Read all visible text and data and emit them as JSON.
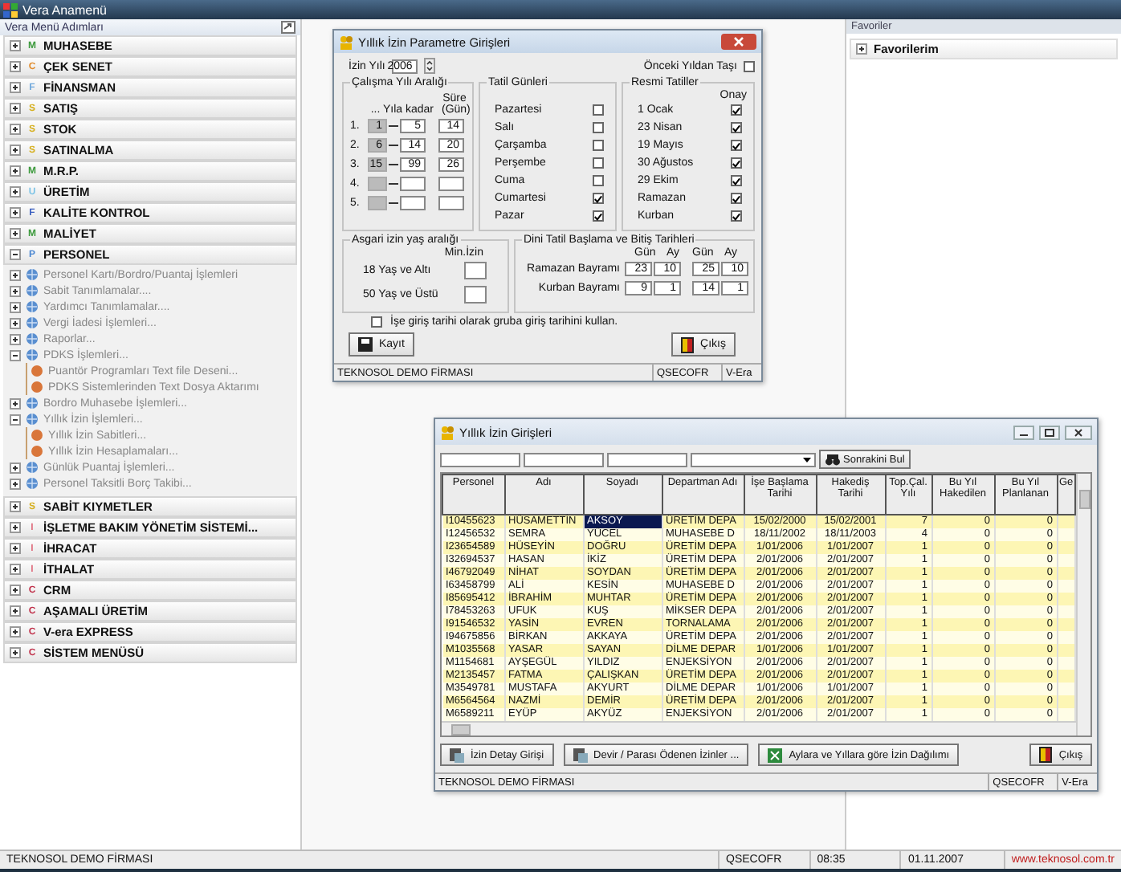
{
  "app": {
    "title": "Vera Anamenü"
  },
  "menu": {
    "title": "Vera Menü Adımları",
    "items": [
      {
        "label": "MUHASEBE",
        "badge": "M",
        "color": "#3c9a3c",
        "expanded": false
      },
      {
        "label": "ÇEK SENET",
        "badge": "C",
        "color": "#e08a2a",
        "expanded": false
      },
      {
        "label": "FİNANSMAN",
        "badge": "F",
        "color": "#6fa8dc",
        "expanded": false
      },
      {
        "label": "SATIŞ",
        "badge": "S",
        "color": "#d6b020",
        "expanded": false
      },
      {
        "label": "STOK",
        "badge": "S",
        "color": "#d6b020",
        "expanded": false
      },
      {
        "label": "SATINALMA",
        "badge": "S",
        "color": "#d6b020",
        "expanded": false
      },
      {
        "label": "M.R.P.",
        "badge": "M",
        "color": "#3c9a3c",
        "expanded": false
      },
      {
        "label": "ÜRETİM",
        "badge": "U",
        "color": "#7ec4e6",
        "expanded": false
      },
      {
        "label": "KALİTE KONTROL",
        "badge": "F",
        "color": "#3a5fc0",
        "expanded": false
      },
      {
        "label": "MALİYET",
        "badge": "M",
        "color": "#3c9a3c",
        "expanded": false
      },
      {
        "label": "PERSONEL",
        "badge": "P",
        "color": "#4a86d0",
        "expanded": true,
        "children": [
          {
            "label": "Personel Kartı/Bordro/Puantaj İşlemleri",
            "kind": "group",
            "expanded": false
          },
          {
            "label": "Sabit Tanımlamalar....",
            "kind": "group",
            "expanded": false
          },
          {
            "label": "Yardımcı Tanımlamalar....",
            "kind": "group",
            "expanded": false
          },
          {
            "label": "Vergi İadesi İşlemleri...",
            "kind": "group",
            "expanded": false
          },
          {
            "label": "Raporlar...",
            "kind": "group",
            "expanded": false
          },
          {
            "label": "PDKS İşlemleri...",
            "kind": "group",
            "expanded": true,
            "children": [
              {
                "label": "Puantör Programları Text file Deseni...",
                "kind": "leaf"
              },
              {
                "label": "PDKS Sistemlerinden Text Dosya Aktarımı",
                "kind": "leaf"
              }
            ]
          },
          {
            "label": "Bordro Muhasebe İşlemleri...",
            "kind": "group",
            "expanded": false
          },
          {
            "label": "Yıllık İzin İşlemleri...",
            "kind": "group",
            "expanded": true,
            "children": [
              {
                "label": "Yıllık İzin Sabitleri...",
                "kind": "leaf"
              },
              {
                "label": "Yıllık İzin Hesaplamaları...",
                "kind": "leaf"
              }
            ]
          },
          {
            "label": "Günlük Puantaj İşlemleri...",
            "kind": "group",
            "expanded": false
          },
          {
            "label": "Personel Taksitli Borç Takibi...",
            "kind": "group",
            "expanded": false
          }
        ]
      },
      {
        "label": "SABİT KIYMETLER",
        "badge": "S",
        "color": "#d6b020",
        "expanded": false
      },
      {
        "label": "İŞLETME BAKIM YÖNETİM SİSTEMİ...",
        "badge": "I",
        "color": "#e07080",
        "expanded": false
      },
      {
        "label": "İHRACAT",
        "badge": "I",
        "color": "#e07080",
        "expanded": false
      },
      {
        "label": "İTHALAT",
        "badge": "I",
        "color": "#e07080",
        "expanded": false
      },
      {
        "label": "CRM",
        "badge": "C",
        "color": "#c0304a",
        "expanded": false
      },
      {
        "label": "AŞAMALI ÜRETİM",
        "badge": "C",
        "color": "#c0304a",
        "expanded": false
      },
      {
        "label": "V-era EXPRESS",
        "badge": "C",
        "color": "#c0304a",
        "expanded": false
      },
      {
        "label": "SİSTEM MENÜSÜ",
        "badge": "C",
        "color": "#c0304a",
        "expanded": false
      }
    ]
  },
  "favorites": {
    "title": "Favoriler",
    "items": [
      {
        "label": "Favorilerim",
        "expanded": false
      }
    ]
  },
  "params_dialog": {
    "title": "Yıllık İzin Parametre Girişleri",
    "year_label": "İzin Yılı",
    "year": "2006",
    "carry_over": {
      "label": "Önceki Yıldan Taşı",
      "checked": false
    },
    "work_ranges": {
      "title": "Çalışma Yılı Aralığı",
      "header_to": "... Yıla kadar",
      "header_days": "Süre (Gün)",
      "rows": [
        {
          "index": "1.",
          "from": "1",
          "to": "5",
          "days": "14"
        },
        {
          "index": "2.",
          "from": "6",
          "to": "14",
          "days": "20"
        },
        {
          "index": "3.",
          "from": "15",
          "to": "99",
          "days": "26"
        },
        {
          "index": "4."
        },
        {
          "index": "5."
        }
      ]
    },
    "holidays": {
      "title": "Tatil Günleri",
      "days": [
        {
          "label": "Pazartesi",
          "checked": false
        },
        {
          "label": "Salı",
          "checked": false
        },
        {
          "label": "Çarşamba",
          "checked": false
        },
        {
          "label": "Perşembe",
          "checked": false
        },
        {
          "label": "Cuma",
          "checked": false
        },
        {
          "label": "Cumartesi",
          "checked": true
        },
        {
          "label": "Pazar",
          "checked": true
        }
      ]
    },
    "official": {
      "title": "Resmi Tatiller",
      "header": "Onay",
      "items": [
        {
          "label": "1 Ocak",
          "checked": true
        },
        {
          "label": "23 Nisan",
          "checked": true
        },
        {
          "label": "19 Mayıs",
          "checked": true
        },
        {
          "label": "30 Ağustos",
          "checked": true
        },
        {
          "label": "29 Ekim",
          "checked": true
        },
        {
          "label": "Ramazan",
          "checked": true
        },
        {
          "label": "Kurban",
          "checked": true
        }
      ]
    },
    "min_age": {
      "title": "Asgari izin yaş aralığı",
      "header": "Min.İzin",
      "rows": [
        {
          "label": "18 Yaş ve Altı"
        },
        {
          "label": "50 Yaş ve Üstü"
        }
      ]
    },
    "religious": {
      "title": "Dini Tatil Başlama ve Bitiş Tarihleri",
      "headers": [
        "Gün",
        "Ay",
        "Gün",
        "Ay"
      ],
      "rows": [
        {
          "label": "Ramazan Bayramı",
          "values": [
            "23",
            "10",
            "25",
            "10"
          ]
        },
        {
          "label": "Kurban Bayramı",
          "values": [
            "9",
            "1",
            "14",
            "1"
          ]
        }
      ]
    },
    "group_date": {
      "label": "İşe giriş tarihi olarak gruba giriş tarihini kullan.",
      "checked": false
    },
    "buttons": [
      {
        "label": "Kayıt",
        "kind": "save"
      },
      {
        "label": "Çıkış",
        "kind": "exit"
      }
    ],
    "status": [
      "TEKNOSOL DEMO FİRMASI",
      "QSECOFR",
      "V-Era"
    ]
  },
  "leave_window": {
    "title": "Yıllık İzin Girişleri",
    "find_button": "Sonrakini Bul",
    "columns": [
      "Personel",
      "Adı",
      "Soyadı",
      "Departman Adı",
      "İşe Başlama Tarihi",
      "Hakediş Tarihi",
      "Top.Çal. Yılı",
      "Bu Yıl Hakedilen",
      "Bu Yıl Planlanan",
      "Ge"
    ],
    "rows": [
      {
        "selected": true,
        "cells": [
          "I10455623",
          "HÜSAMETTİN",
          "AKSOY",
          "ÜRETİM DEPA",
          "15/02/2000",
          "15/02/2001",
          "7",
          "0",
          "0"
        ]
      },
      {
        "selected": false,
        "cells": [
          "I12456532",
          "SEMRA",
          "YÜCEL",
          "MUHASEBE D",
          "18/11/2002",
          "18/11/2003",
          "4",
          "0",
          "0"
        ]
      },
      {
        "selected": false,
        "cells": [
          "I23654589",
          "HÜSEYİN",
          "DOĞRU",
          "ÜRETİM DEPA",
          "1/01/2006",
          "1/01/2007",
          "1",
          "0",
          "0"
        ]
      },
      {
        "selected": false,
        "cells": [
          "I32694537",
          "HASAN",
          "İKİZ",
          "ÜRETİM DEPA",
          "2/01/2006",
          "2/01/2007",
          "1",
          "0",
          "0"
        ]
      },
      {
        "selected": false,
        "cells": [
          "I46792049",
          "NİHAT",
          "SOYDAN",
          "ÜRETİM DEPA",
          "2/01/2006",
          "2/01/2007",
          "1",
          "0",
          "0"
        ]
      },
      {
        "selected": false,
        "cells": [
          "I63458799",
          "ALİ",
          "KESİN",
          "MUHASEBE D",
          "2/01/2006",
          "2/01/2007",
          "1",
          "0",
          "0"
        ]
      },
      {
        "selected": false,
        "cells": [
          "I85695412",
          "İBRAHİM",
          "MUHTAR",
          "ÜRETİM DEPA",
          "2/01/2006",
          "2/01/2007",
          "1",
          "0",
          "0"
        ]
      },
      {
        "selected": false,
        "cells": [
          "I78453263",
          "UFUK",
          "KUŞ",
          "MİKSER DEPA",
          "2/01/2006",
          "2/01/2007",
          "1",
          "0",
          "0"
        ]
      },
      {
        "selected": false,
        "cells": [
          "I91546532",
          "YASİN",
          "EVREN",
          "TORNALAMA",
          "2/01/2006",
          "2/01/2007",
          "1",
          "0",
          "0"
        ]
      },
      {
        "selected": false,
        "cells": [
          "I94675856",
          "BİRKAN",
          "AKKAYA",
          "ÜRETİM DEPA",
          "2/01/2006",
          "2/01/2007",
          "1",
          "0",
          "0"
        ]
      },
      {
        "selected": false,
        "cells": [
          "M1035568",
          "YASAR",
          "SAYAN",
          "DİLME DEPAR",
          "1/01/2006",
          "1/01/2007",
          "1",
          "0",
          "0"
        ]
      },
      {
        "selected": false,
        "cells": [
          "M1154681",
          "AYŞEGÜL",
          "YILDIZ",
          "ENJEKSİYON",
          "2/01/2006",
          "2/01/2007",
          "1",
          "0",
          "0"
        ]
      },
      {
        "selected": false,
        "cells": [
          "M2135457",
          "FATMA",
          "ÇALIŞKAN",
          "ÜRETİM DEPA",
          "2/01/2006",
          "2/01/2007",
          "1",
          "0",
          "0"
        ]
      },
      {
        "selected": false,
        "cells": [
          "M3549781",
          "MUSTAFA",
          "AKYURT",
          "DİLME DEPAR",
          "1/01/2006",
          "1/01/2007",
          "1",
          "0",
          "0"
        ]
      },
      {
        "selected": false,
        "cells": [
          "M6564564",
          "NAZMİ",
          "DEMİR",
          "ÜRETİM DEPA",
          "2/01/2006",
          "2/01/2007",
          "1",
          "0",
          "0"
        ]
      },
      {
        "selected": false,
        "cells": [
          "M6589211",
          "EYÜP",
          "AKYÜZ",
          "ENJEKSİYON",
          "2/01/2006",
          "2/01/2007",
          "1",
          "0",
          "0"
        ]
      }
    ],
    "buttons": [
      {
        "label": "İzin Detay Girişi",
        "kind": "report"
      },
      {
        "label": "Devir / Parası Ödenen İzinler ...",
        "kind": "report"
      },
      {
        "label": "Aylara ve Yıllara göre İzin Dağılımı",
        "kind": "sheet"
      },
      {
        "label": "Çıkış",
        "kind": "exit"
      }
    ],
    "status": [
      "TEKNOSOL DEMO FİRMASI",
      "QSECOFR",
      "V-Era"
    ]
  },
  "status_bar": {
    "texts": [
      "TEKNOSOL DEMO FİRMASI",
      "QSECOFR",
      "08:35",
      "01.11.2007"
    ],
    "link": "www.teknosol.com.tr"
  }
}
